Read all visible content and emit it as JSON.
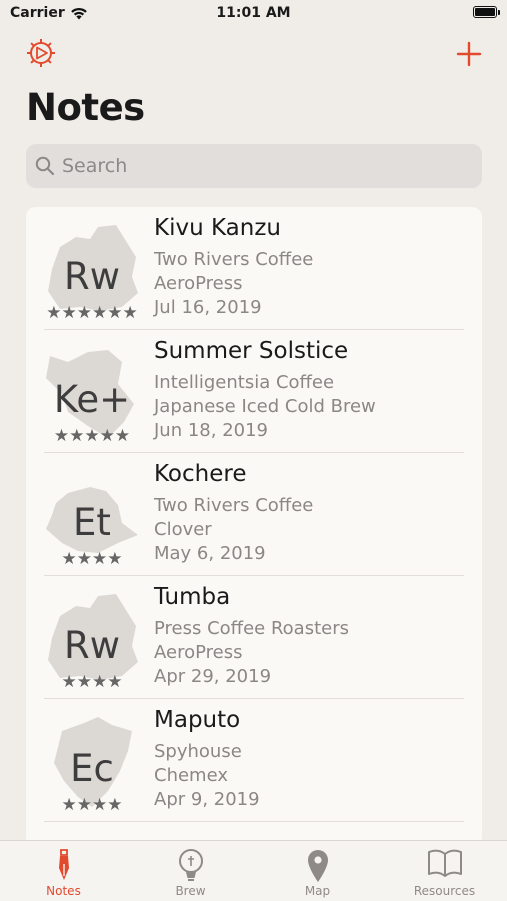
{
  "status": {
    "carrier": "Carrier",
    "time": "11:01 AM"
  },
  "header": {
    "title": "Notes"
  },
  "search": {
    "placeholder": "Search"
  },
  "notes": [
    {
      "code": "Rw",
      "stars": "★★★★★★",
      "title": "Kivu Kanzu",
      "roaster": "Two Rivers Coffee",
      "method": "AeroPress",
      "date": "Jul 16, 2019"
    },
    {
      "code": "Ke+",
      "stars": "★★★★★",
      "title": "Summer Solstice",
      "roaster": "Intelligentsia Coffee",
      "method": "Japanese Iced Cold Brew",
      "date": "Jun 18, 2019"
    },
    {
      "code": "Et",
      "stars": "★★★★",
      "title": "Kochere",
      "roaster": "Two Rivers Coffee",
      "method": "Clover",
      "date": "May 6, 2019"
    },
    {
      "code": "Rw",
      "stars": "★★★★",
      "title": "Tumba",
      "roaster": "Press Coffee Roasters",
      "method": "AeroPress",
      "date": "Apr 29, 2019"
    },
    {
      "code": "Ec",
      "stars": "★★★★",
      "title": "Maputo",
      "roaster": "Spyhouse",
      "method": "Chemex",
      "date": "Apr 9, 2019"
    }
  ],
  "tabs": [
    {
      "label": "Notes",
      "icon": "pen-nib-icon",
      "active": true
    },
    {
      "label": "Brew",
      "icon": "lightbulb-icon",
      "active": false
    },
    {
      "label": "Map",
      "icon": "map-pin-icon",
      "active": false
    },
    {
      "label": "Resources",
      "icon": "book-icon",
      "active": false
    }
  ],
  "colors": {
    "accent": "#e24a2d",
    "background": "#f0ede8",
    "card": "#fbf9f6",
    "map_shape": "#dcd9d5"
  }
}
